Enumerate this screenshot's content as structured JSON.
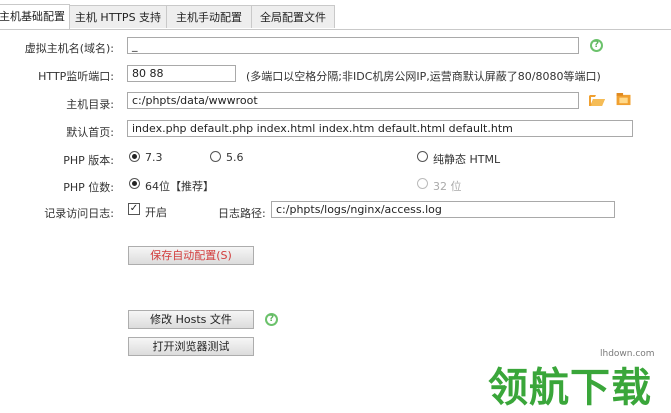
{
  "tabs": [
    {
      "label": "主机基础配置",
      "active": true
    },
    {
      "label": "主机 HTTPS 支持",
      "active": false
    },
    {
      "label": "主机手动配置",
      "active": false
    },
    {
      "label": "全局配置文件",
      "active": false
    }
  ],
  "form": {
    "hostname": {
      "label": "虚拟主机名(域名):",
      "value": "_"
    },
    "port": {
      "label": "HTTP监听端口:",
      "value": "80 88",
      "hint": "(多端口以空格分隔;非IDC机房公网IP,运营商默认屏蔽了80/8080等端口)"
    },
    "dir": {
      "label": "主机目录:",
      "value": "c:/phpts/data/wwwroot"
    },
    "index": {
      "label": "默认首页:",
      "value": "index.php default.php index.html index.htm default.html default.htm"
    },
    "php_version": {
      "label": "PHP 版本:",
      "options": [
        "7.3",
        "5.6",
        "纯静态 HTML"
      ],
      "selected": "7.3"
    },
    "php_bits": {
      "label": "PHP 位数:",
      "options": [
        "64位【推荐】",
        "32 位"
      ],
      "selected": "64位【推荐】"
    },
    "log": {
      "label": "记录访问日志:",
      "checkbox_label": "开启",
      "checked": true,
      "path_label": "日志路径:",
      "path_value": "c:/phpts/logs/nginx/access.log"
    }
  },
  "buttons": {
    "save": "保存自动配置(S)",
    "hosts": "修改 Hosts 文件",
    "browser": "打开浏览器测试"
  },
  "watermark": {
    "text": "领航下载",
    "url": "lhdown.com"
  },
  "colors": {
    "accent_green": "#6cc26c",
    "save_red": "#d23c3c",
    "folder_orange": "#f0a030",
    "watermark_green": "#3aa63a"
  }
}
